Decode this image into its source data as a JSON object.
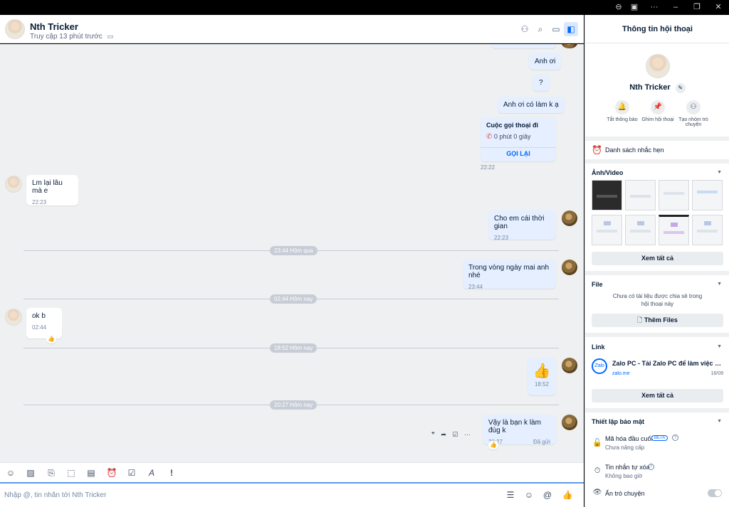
{
  "titlebar": {
    "zoom_icon": "⊖",
    "screen_icon": "▣",
    "more_icon": "···",
    "minimize_icon": "–",
    "restore_icon": "❐",
    "close_icon": "✕"
  },
  "header": {
    "name": "Nth Tricker",
    "status": "Truy cập 13 phút trước",
    "label_icon": "▭",
    "icons": {
      "add_member": "⚇",
      "search": "⌕",
      "video": "▭",
      "panel": "◧"
    }
  },
  "messages": {
    "items": [
      {
        "side": "me",
        "text": "Anh ơi"
      },
      {
        "side": "me",
        "text": "?"
      },
      {
        "side": "me",
        "text": "Anh ơi có làm k ạ"
      },
      {
        "side": "me",
        "type": "call",
        "title": "Cuộc gọi thoại đi",
        "detail": "0 phút 0 giây",
        "action": "GỌI LẠI",
        "time": "22:22"
      },
      {
        "side": "them",
        "text": "Lm lại lâu mà e",
        "time": "22:23"
      },
      {
        "side": "me",
        "text": "Cho em cái thời gian",
        "time": "22:23"
      },
      {
        "side": "me",
        "text": "Trong vòng ngày mai anh nhé",
        "time": "23:44"
      },
      {
        "side": "them",
        "text": "ok b",
        "time": "02:44"
      },
      {
        "side": "me",
        "type": "sticker",
        "text": "👍",
        "time": "18:52"
      },
      {
        "side": "me",
        "text": "Vậy là bạn k làm đúg k",
        "time": "20:27",
        "status": "Đã gửi"
      }
    ],
    "dividers": [
      "23:44 Hôm qua",
      "02:44 Hôm nay",
      "18:52 Hôm nay",
      "20:27 Hôm nay"
    ],
    "hover_actions": {
      "quote": "❞",
      "forward": "➦",
      "task": "☑",
      "more": "···"
    },
    "reaction_icon": "👍"
  },
  "toolbar": {
    "icons": {
      "sticker": "☺",
      "image": "▨",
      "attach": "⎘",
      "screenshot": "⬚",
      "contact_card": "▤",
      "reminder": "⏰",
      "todo": "☑",
      "format": "A",
      "important": "!"
    }
  },
  "composer": {
    "placeholder": "Nhập @, tin nhắn tới Nth Tricker",
    "icons": {
      "quick_message": "☰",
      "emoji": "☺",
      "mention": "@",
      "like": "👍"
    }
  },
  "panel": {
    "title": "Thông tin hội thoại",
    "profile_name": "Nth Tricker",
    "edit_icon": "✎",
    "actions": [
      {
        "icon": "🔔",
        "label": "Tắt thông báo"
      },
      {
        "icon": "📌",
        "label": "Ghim hội thoại"
      },
      {
        "icon": "⚇",
        "label": "Tạo nhóm trò chuyện"
      }
    ],
    "reminders": {
      "icon": "⏰",
      "label": "Danh sách nhắc hẹn"
    },
    "media": {
      "title": "Ảnh/Video",
      "view_all": "Xem tất cả",
      "caret": "▼"
    },
    "files": {
      "title": "File",
      "empty": "Chưa có tài liệu được chia sẻ trong hội thoại này",
      "add_button": "Thêm Files",
      "add_icon": "🗋",
      "caret": "▼"
    },
    "links": {
      "title": "Link",
      "caret": "▼",
      "item": {
        "logo": "Zalo",
        "title": "Zalo PC - Tải Zalo PC để làm việc nhóm...",
        "domain": "zalo.me",
        "date": "16/09"
      },
      "view_all": "Xem tất cả"
    },
    "security": {
      "title": "Thiết lập bảo mật",
      "caret": "▼",
      "e2ee": {
        "icon": "🔓",
        "label": "Mã hóa đầu cuối",
        "badge": "BETA",
        "help": "?",
        "sub": "Chưa nâng cấp"
      },
      "auto_delete": {
        "icon": "⏱",
        "label": "Tin nhắn tự xóa",
        "help": "?",
        "sub": "Không bao giờ"
      },
      "hide": {
        "icon": "👁",
        "label": "Ẩn trò chuyện"
      }
    }
  }
}
